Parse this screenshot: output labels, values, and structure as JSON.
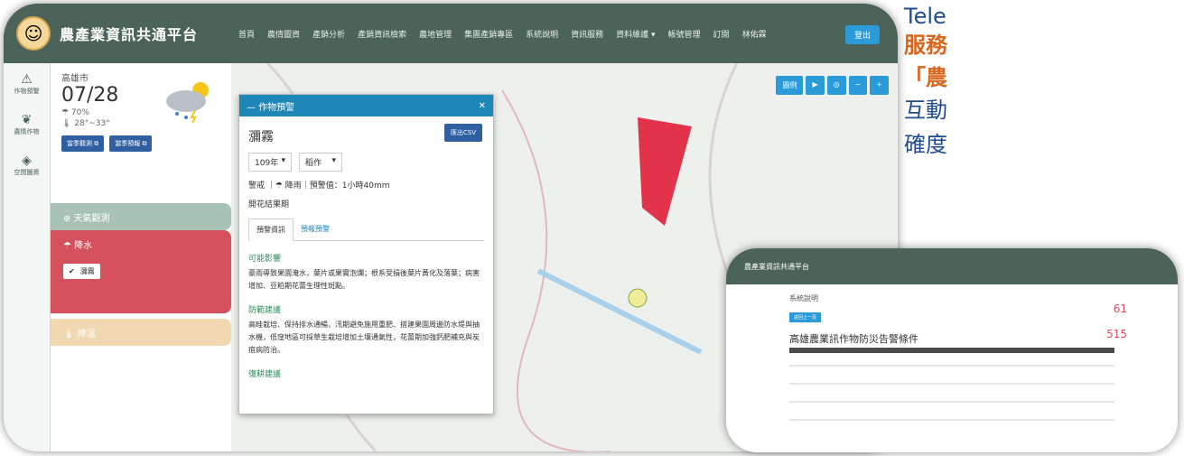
{
  "headline": {
    "line1": "Tele",
    "line2": "服務",
    "line3": "「農",
    "line4": "互動",
    "line5": "確度"
  },
  "app": {
    "title": "農產業資訊共通平台",
    "nav": [
      "首頁",
      "農情圖資",
      "產銷分析",
      "產銷資訊檢索",
      "農地管理",
      "集團產銷專區",
      "系統說明",
      "資訊服務",
      "資料維護 ▾",
      "帳號管理",
      "訂閱",
      "林佑霖"
    ],
    "login": "登出"
  },
  "sidebar": {
    "items": [
      {
        "icon": "warning-icon",
        "glyph": "⚠",
        "label": "作物預警"
      },
      {
        "icon": "crop-icon",
        "glyph": "❦",
        "label": "農情作物"
      },
      {
        "icon": "layers-icon",
        "glyph": "◈",
        "label": "空間圖資"
      }
    ]
  },
  "weather": {
    "city": "高雄市",
    "date": "07/28",
    "humidity": "☂ 70%",
    "temperature": "🌡 28°~33°",
    "btn_observe": "當季觀測 ⧉",
    "btn_forecast": "當季預報 ⧉"
  },
  "accordion": {
    "observe": "⊕ 天氣觀測",
    "rain": "☂ 降水",
    "rain_item": "瀰霧",
    "temp": "🌡 降溫"
  },
  "map_tools": [
    "圖例",
    "▶",
    "◎",
    "−",
    "+"
  ],
  "popup": {
    "header": "— 作物預警",
    "close": "✕",
    "title": "瀰霧",
    "csv": "匯出CSV",
    "year": "109年",
    "crop": "稻作",
    "warning": "警戒 ｜☂ 降雨｜預警值：1小時40mm",
    "stage": "開花結果期",
    "tab1": "預警資訊",
    "tab2": "預報預警",
    "impact_title": "可能影響",
    "impact_text": "豪雨導致果園淹水，葉片或果實泡爛；根系受損後葉片黃化及落葉；病害增加、豆粕期花蕾生理性斑點。",
    "prevent_title": "防範建議",
    "prevent_text": "高畦栽培、保持排水通暢，汛期避免施用重肥、搭建果園周邊防水堤與抽水機，低窪地區可採草生栽培增加土壤通氣性，花蕾期加強鈣肥補充與炭疽病防治。",
    "recover_title": "復耕建議"
  },
  "second": {
    "app_title": "農產業資訊共通平台",
    "section": "系統說明",
    "btn": "返回上一頁",
    "title": "高雄農業訊作物防災告警條件",
    "num1": "61",
    "num2": "515"
  },
  "colors": {
    "topbar": "#4b6358",
    "accent": "#2a9bd8",
    "rain": "#d4505c",
    "headline_blue": "#1f4c8e",
    "headline_orange": "#d9661e"
  }
}
